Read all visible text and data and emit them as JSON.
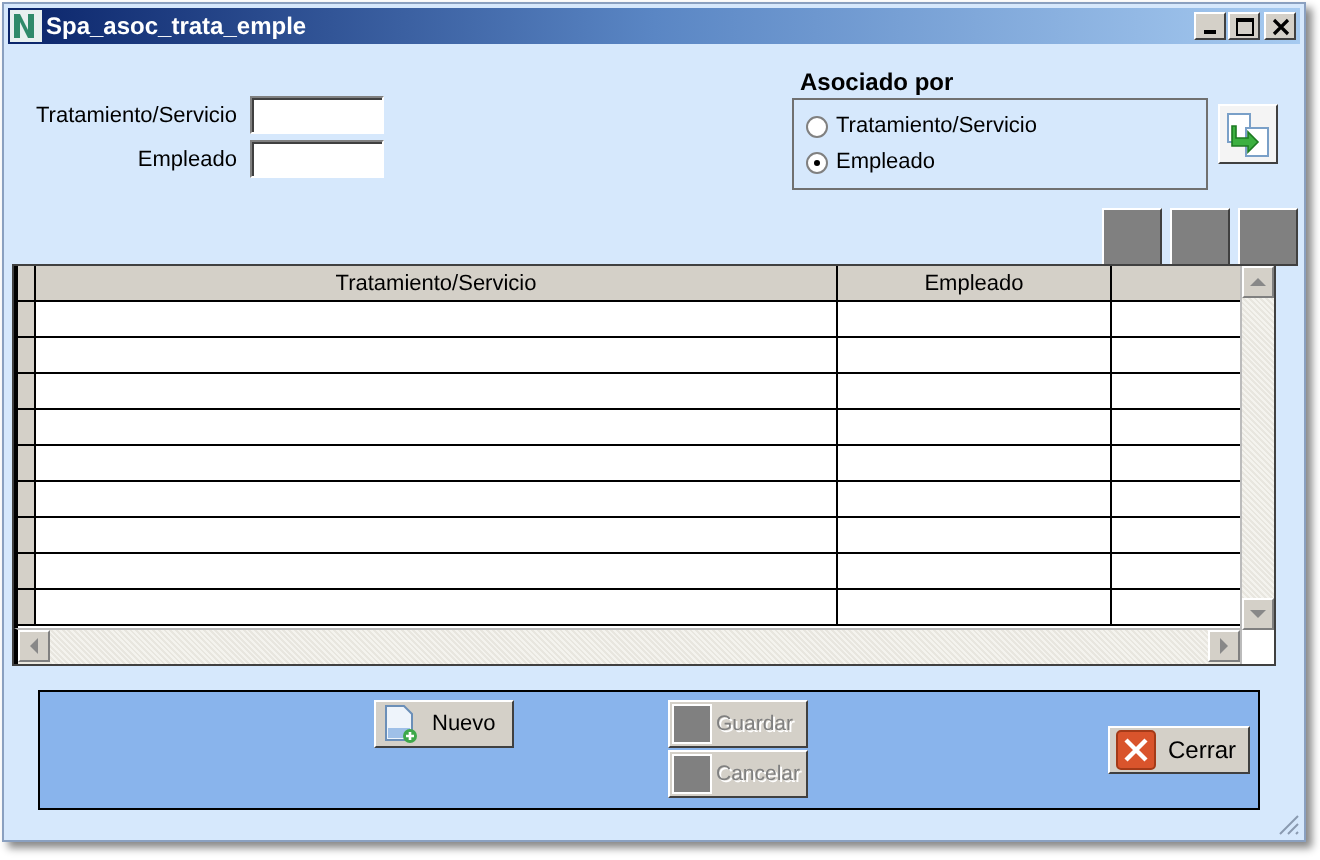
{
  "window": {
    "title": "Spa_asoc_trata_emple"
  },
  "filters": [
    {
      "label": "Tratamiento/Servicio"
    },
    {
      "label": "Empleado"
    }
  ],
  "association": {
    "title": "Asociado por",
    "options": [
      {
        "label": "Tratamiento/Servicio",
        "selected": false
      },
      {
        "label": "Empleado",
        "selected": true
      }
    ]
  },
  "grid": {
    "columns": [
      "Tratamiento/Servicio",
      "Empleado"
    ]
  },
  "buttons": [
    {
      "kind": "new",
      "label": "Nuevo",
      "disabled": false
    },
    {
      "kind": "save",
      "label": "Guardar",
      "disabled": true
    },
    {
      "kind": "cancel",
      "label": "Cancelar",
      "disabled": true
    },
    {
      "kind": "close",
      "label": "Cerrar",
      "disabled": false
    }
  ]
}
